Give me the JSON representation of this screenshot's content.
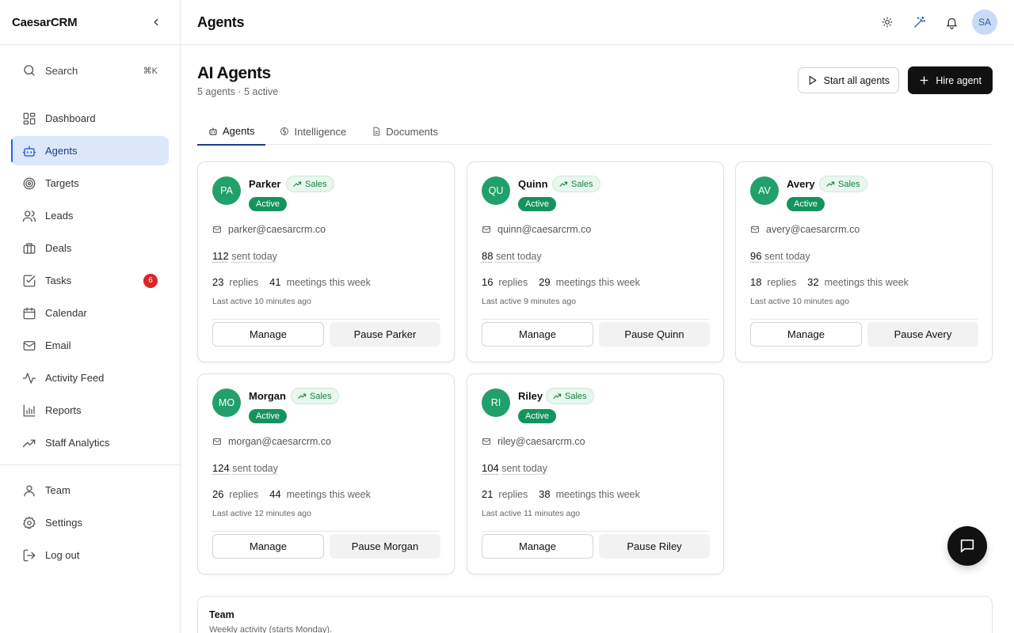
{
  "app": {
    "brand": "CaesarCRM"
  },
  "sidebar": {
    "search": {
      "label": "Search",
      "shortcut": "⌘K"
    },
    "nav": [
      {
        "label": "Dashboard",
        "icon": "dashboard-icon"
      },
      {
        "label": "Agents",
        "icon": "bot-icon",
        "active": true
      },
      {
        "label": "Targets",
        "icon": "target-icon"
      },
      {
        "label": "Leads",
        "icon": "users-icon"
      },
      {
        "label": "Deals",
        "icon": "briefcase-icon"
      },
      {
        "label": "Tasks",
        "icon": "checkbox-icon",
        "badge": "6"
      },
      {
        "label": "Calendar",
        "icon": "calendar-icon"
      },
      {
        "label": "Email",
        "icon": "mail-icon"
      },
      {
        "label": "Activity Feed",
        "icon": "activity-icon"
      },
      {
        "label": "Reports",
        "icon": "bar-chart-icon"
      },
      {
        "label": "Staff Analytics",
        "icon": "trending-up-icon"
      }
    ],
    "bottom_nav": [
      {
        "label": "Team",
        "icon": "user-icon"
      },
      {
        "label": "Settings",
        "icon": "gear-icon"
      },
      {
        "label": "Log out",
        "icon": "logout-icon"
      }
    ]
  },
  "topbar": {
    "title": "Agents",
    "avatar_initials": "SA"
  },
  "page": {
    "title": "AI Agents",
    "subtitle": "5 agents · 5 active",
    "start_all_label": "Start all agents",
    "hire_label": "Hire agent"
  },
  "tabs": [
    {
      "label": "Agents",
      "icon": "bot-icon",
      "active": true
    },
    {
      "label": "Intelligence",
      "icon": "brain-icon"
    },
    {
      "label": "Documents",
      "icon": "document-icon"
    }
  ],
  "agents": [
    {
      "initials": "PA",
      "name": "Parker",
      "tag": "Sales",
      "status": "Active",
      "email": "parker@caesarcrm.co",
      "sent": "112",
      "sent_label": "sent today",
      "replies": "23",
      "replies_label": "replies",
      "meetings": "41",
      "meetings_label": "meetings this week",
      "last_active": "Last active 10 minutes ago",
      "manage_label": "Manage",
      "pause_label": "Pause Parker"
    },
    {
      "initials": "QU",
      "name": "Quinn",
      "tag": "Sales",
      "status": "Active",
      "email": "quinn@caesarcrm.co",
      "sent": "88",
      "sent_label": "sent today",
      "replies": "16",
      "replies_label": "replies",
      "meetings": "29",
      "meetings_label": "meetings this week",
      "last_active": "Last active 9 minutes ago",
      "manage_label": "Manage",
      "pause_label": "Pause Quinn"
    },
    {
      "initials": "AV",
      "name": "Avery",
      "tag": "Sales",
      "status": "Active",
      "email": "avery@caesarcrm.co",
      "sent": "96",
      "sent_label": "sent today",
      "replies": "18",
      "replies_label": "replies",
      "meetings": "32",
      "meetings_label": "meetings this week",
      "last_active": "Last active 10 minutes ago",
      "manage_label": "Manage",
      "pause_label": "Pause Avery"
    },
    {
      "initials": "MO",
      "name": "Morgan",
      "tag": "Sales",
      "status": "Active",
      "email": "morgan@caesarcrm.co",
      "sent": "124",
      "sent_label": "sent today",
      "replies": "26",
      "replies_label": "replies",
      "meetings": "44",
      "meetings_label": "meetings this week",
      "last_active": "Last active 12 minutes ago",
      "manage_label": "Manage",
      "pause_label": "Pause Morgan"
    },
    {
      "initials": "RI",
      "name": "Riley",
      "tag": "Sales",
      "status": "Active",
      "email": "riley@caesarcrm.co",
      "sent": "104",
      "sent_label": "sent today",
      "replies": "21",
      "replies_label": "replies",
      "meetings": "38",
      "meetings_label": "meetings this week",
      "last_active": "Last active 11 minutes ago",
      "manage_label": "Manage",
      "pause_label": "Pause Riley"
    }
  ],
  "team_panel": {
    "title": "Team",
    "subtitle": "Weekly activity (starts Monday)."
  },
  "colors": {
    "accent": "#2563eb",
    "active_nav_bg": "#dbe8f9",
    "agent_avatar": "#22a06b",
    "status_active": "#15935e",
    "badge": "#dc2626"
  }
}
